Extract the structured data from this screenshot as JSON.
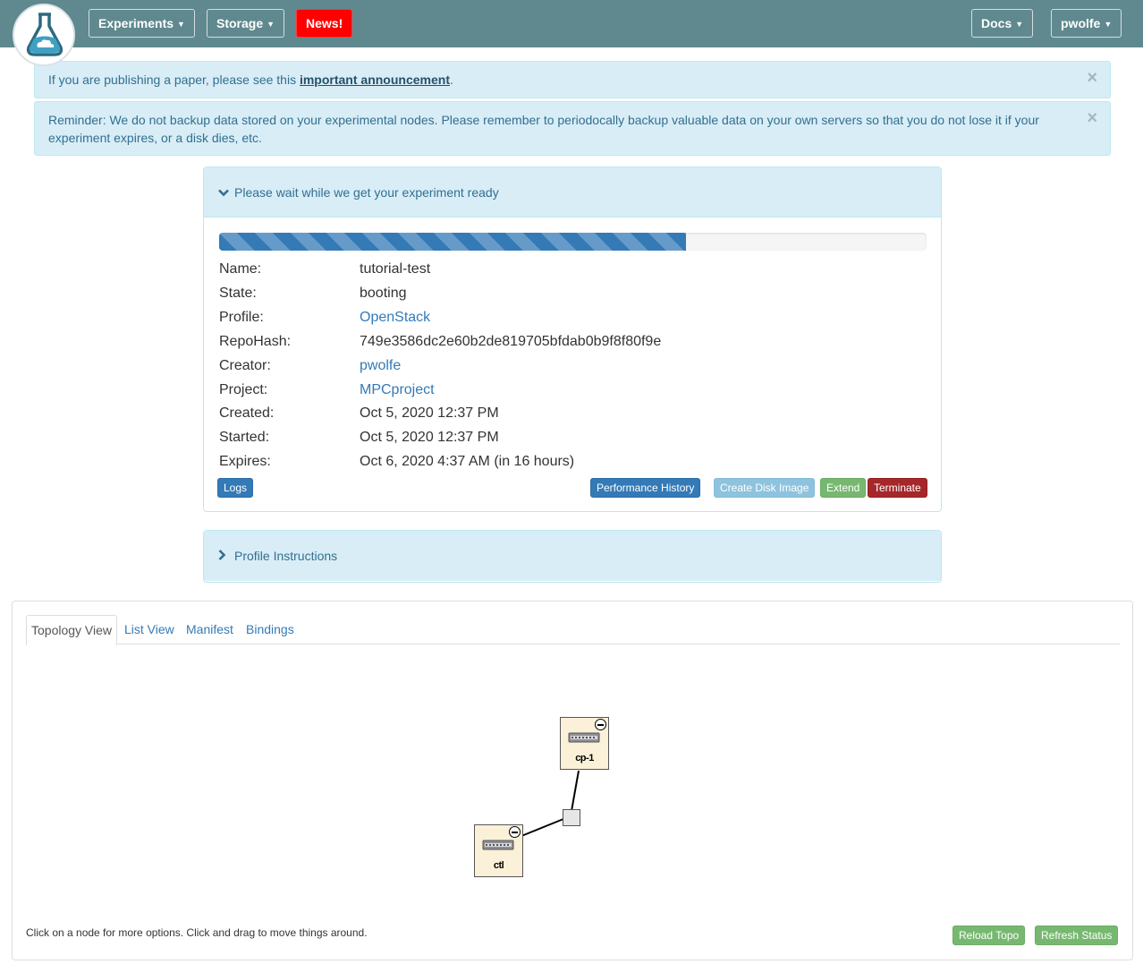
{
  "navbar": {
    "logo_icon": "flask-cloud-icon",
    "experiments_label": "Experiments",
    "storage_label": "Storage",
    "news_label": "News!",
    "docs_label": "Docs",
    "user_label": "pwolfe",
    "colors": {
      "bar": "#5f898e",
      "news": "#ff0000"
    }
  },
  "alerts": {
    "paper": {
      "text_before": "If you are publishing a paper, please see this ",
      "link": "important announcement",
      "text_after": "."
    },
    "reminder": {
      "text": "Reminder: We do not backup data stored on your experimental nodes. Please remember to periodocally backup valuable data on your own servers so that you do not lose it if your experiment expires, or a disk dies, etc."
    },
    "close_symbol": "×"
  },
  "status_panel": {
    "title": "Please wait while we get your experiment ready",
    "progress_percent": 66,
    "fields": [
      {
        "label": "Name:",
        "value": "tutorial-test",
        "link": false
      },
      {
        "label": "State:",
        "value": "booting",
        "link": false
      },
      {
        "label": "Profile:",
        "value": "OpenStack",
        "link": true
      },
      {
        "label": "RepoHash:",
        "value": "749e3586dc2e60b2de819705bfdab0b9f8f80f9e",
        "link": false
      },
      {
        "label": "Creator:",
        "value": "pwolfe",
        "link": true
      },
      {
        "label": "Project:",
        "value": "MPCproject",
        "link": true
      },
      {
        "label": "Created:",
        "value": "Oct 5, 2020 12:37 PM",
        "link": false
      },
      {
        "label": "Started:",
        "value": "Oct 5, 2020 12:37 PM",
        "link": false
      },
      {
        "label": "Expires:",
        "value": "Oct 6, 2020 4:37 AM (in 16 hours)",
        "link": false
      }
    ],
    "buttons": {
      "logs": "Logs",
      "performance_history": "Performance History",
      "create_disk_image": "Create Disk Image",
      "extend": "Extend",
      "terminate": "Terminate"
    }
  },
  "instructions_panel": {
    "title": "Profile Instructions"
  },
  "topology": {
    "tabs": [
      "Topology View",
      "List View",
      "Manifest",
      "Bindings"
    ],
    "active_tab": "Topology View",
    "nodes": [
      {
        "name": "cp-1",
        "icon": "switch-icon"
      },
      {
        "name": "ctl",
        "icon": "switch-icon"
      }
    ],
    "lan_icon": "lan-box-icon",
    "hint": "Click on a node for more options. Click and drag to move things around.",
    "reload_label": "Reload Topo",
    "refresh_label": "Refresh Status"
  }
}
